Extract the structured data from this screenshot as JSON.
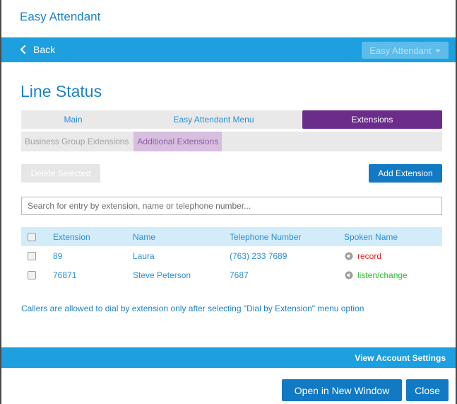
{
  "app": {
    "title": "Easy Attendant"
  },
  "nav": {
    "back_label": "Back",
    "dropdown_label": "Easy Attendant"
  },
  "page": {
    "title": "Line Status"
  },
  "tabs": [
    {
      "label": "Main",
      "active": false
    },
    {
      "label": "Easy Attendant Menu",
      "active": false
    },
    {
      "label": "Extensions",
      "active": true
    }
  ],
  "subtabs": [
    {
      "label": "Business Group Extensions",
      "active": false
    },
    {
      "label": "Additional Extensions",
      "active": true
    }
  ],
  "actions": {
    "delete_label": "Delete Selected",
    "add_label": "Add Extension"
  },
  "search": {
    "placeholder": "Search for entry by extension, name or telephone number..."
  },
  "table": {
    "headers": {
      "extension": "Extension",
      "name": "Name",
      "telephone": "Telephone Number",
      "spoken": "Spoken Name"
    },
    "rows": [
      {
        "extension": "89",
        "name": "Laura",
        "telephone": "(763) 233 7689",
        "spoken": "record"
      },
      {
        "extension": "76871",
        "name": "Steve Peterson",
        "telephone": "7687",
        "spoken": "listen/change"
      }
    ]
  },
  "note": "Callers are allowed to dial by extension only after selecting \"Dial by Extension\" menu option",
  "footer": {
    "settings_label": "View Account Settings"
  },
  "bottom": {
    "open_label": "Open in New Window",
    "close_label": "Close"
  },
  "colors": {
    "accent": "#1e9fe0",
    "active_tab": "#6b2c8a",
    "record": "#ea1a1a",
    "listen": "#2fbd2f"
  }
}
